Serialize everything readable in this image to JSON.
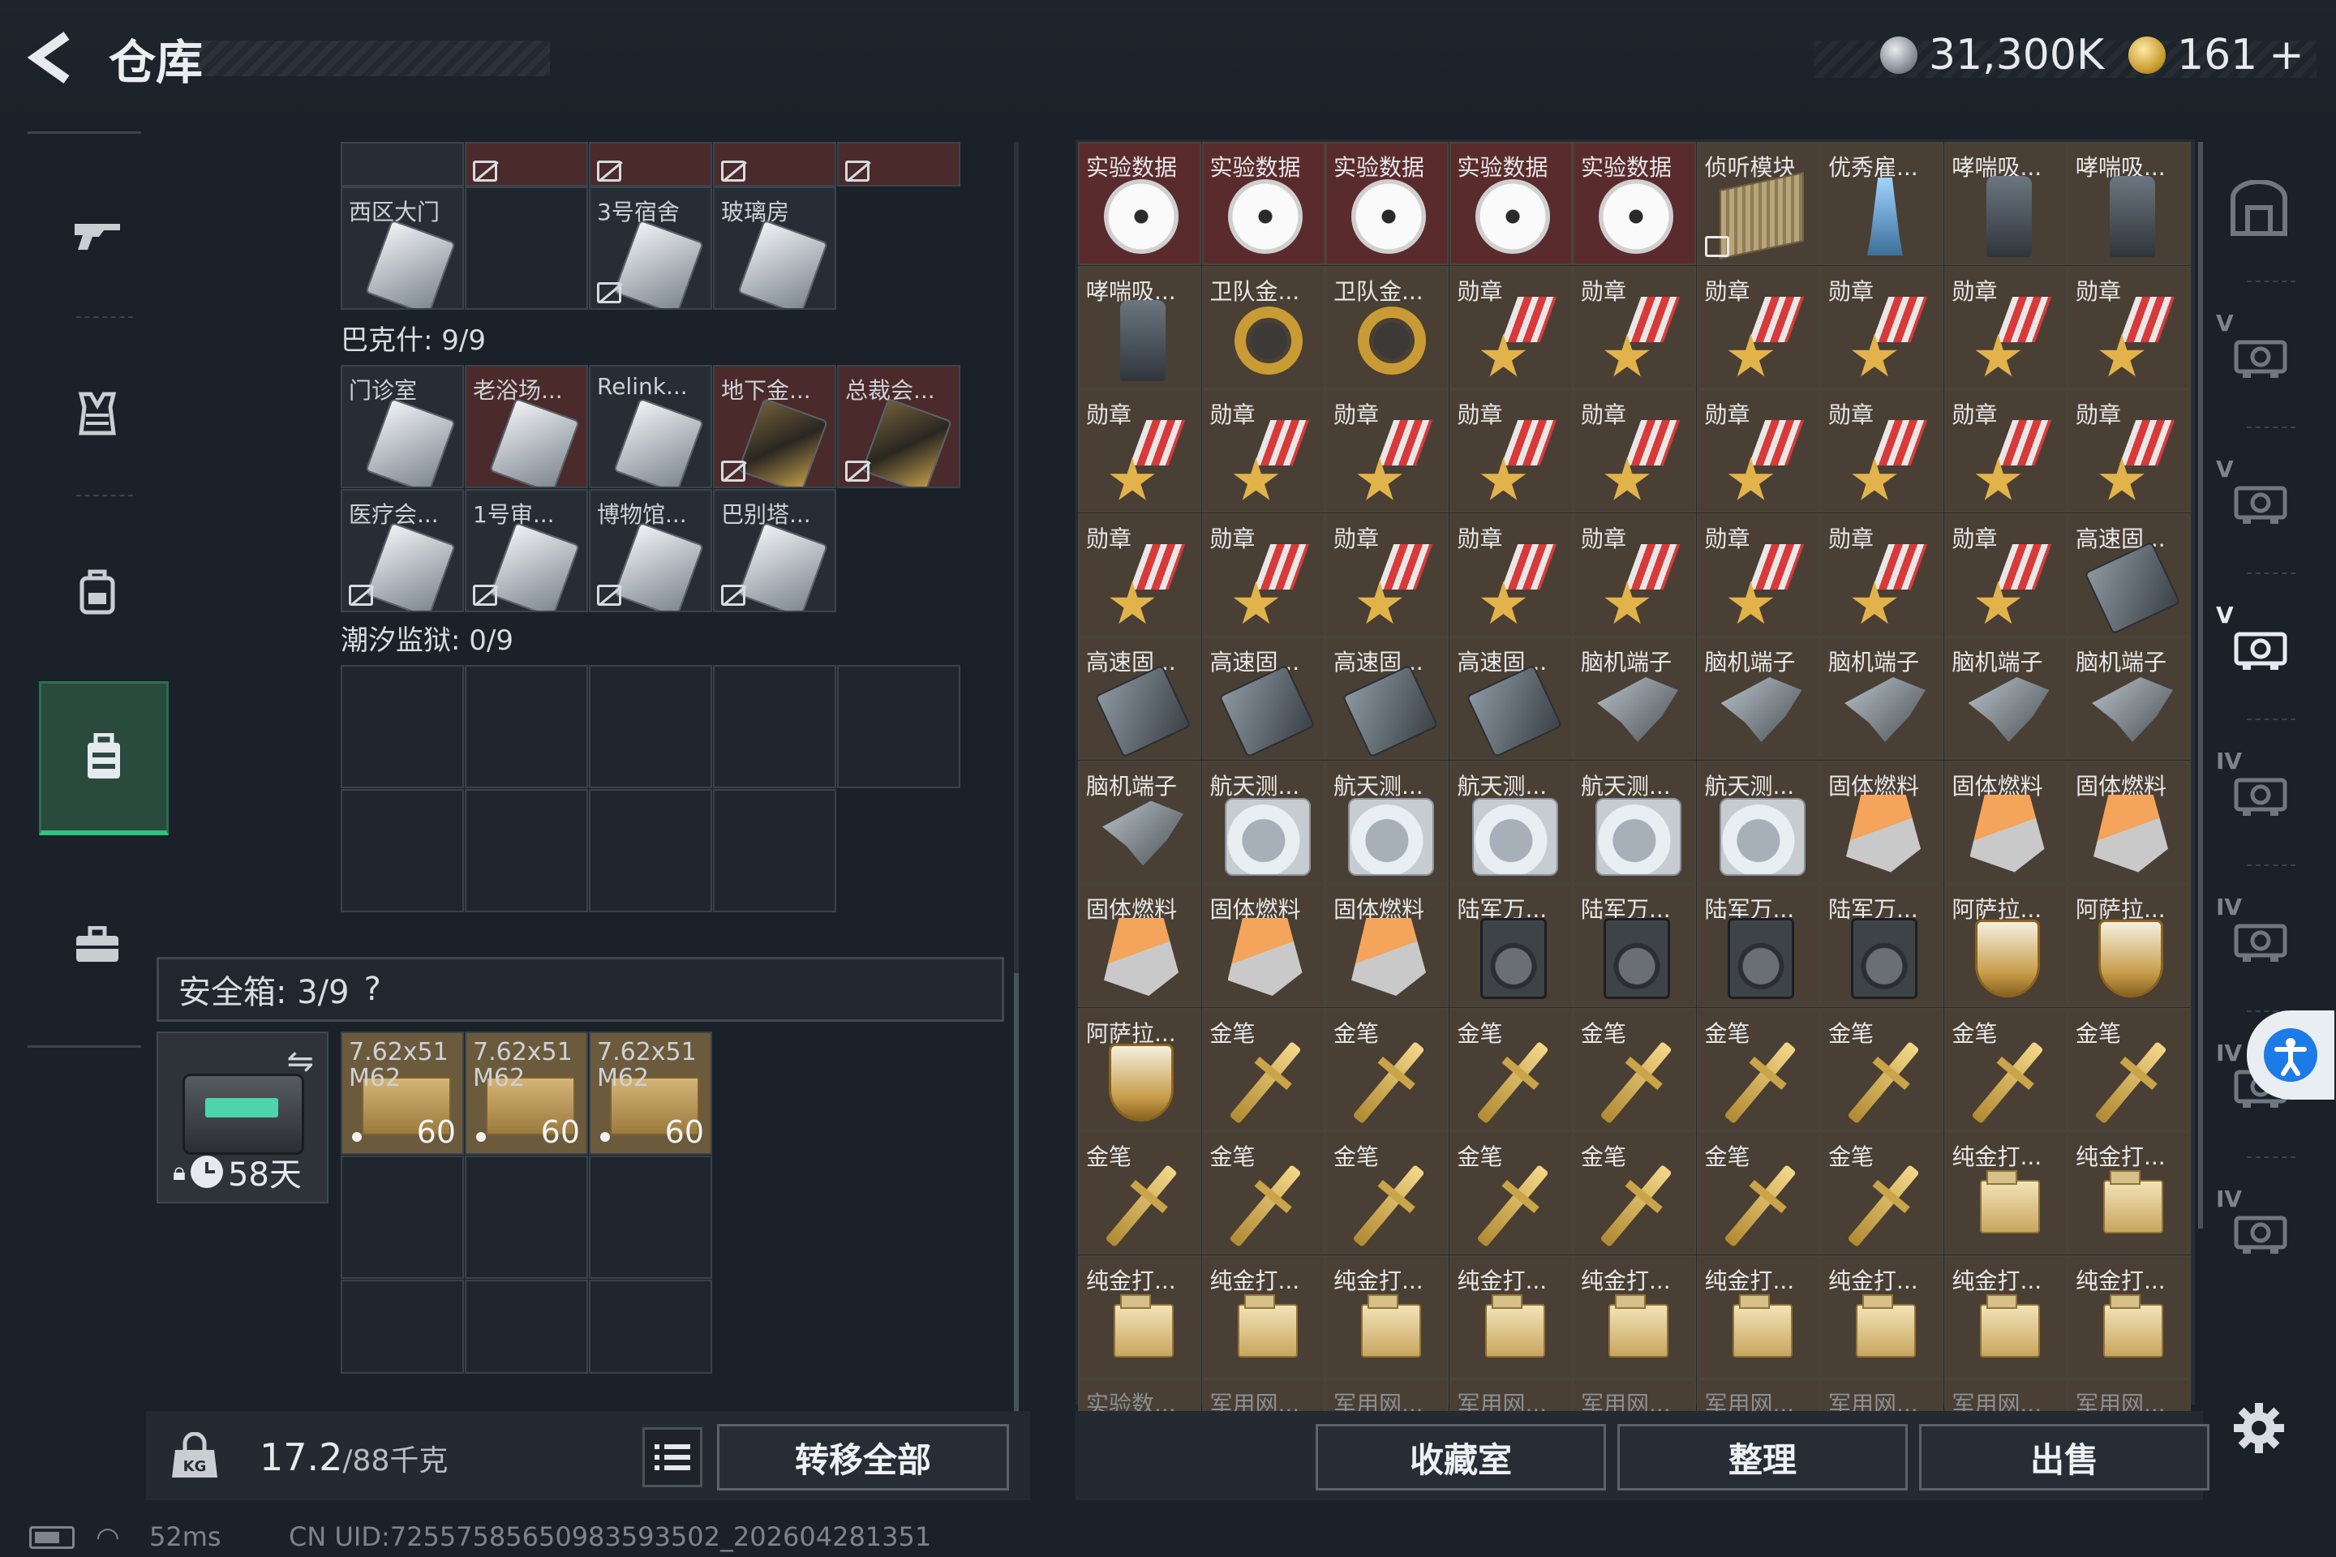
{
  "header": {
    "title": "仓库",
    "silver": "31,300K",
    "gold": "161",
    "gold_plus": "+"
  },
  "nav": {
    "items": [
      "weapon-icon",
      "armor-icon",
      "backpack-icon",
      "container-icon",
      "briefcase-icon"
    ],
    "active_index": 3
  },
  "keycards": {
    "top_row_labels": [
      "",
      "",
      "",
      "",
      ""
    ],
    "row1_labels": [
      "西区大门",
      "",
      "3号宿舍",
      "玻璃房"
    ],
    "section_bakshi": "巴克什: 9/9",
    "bakshi_row1": [
      "门诊室",
      "老浴场...",
      "Relink...",
      "地下金...",
      "总裁会..."
    ],
    "bakshi_row2": [
      "医疗会...",
      "1号审...",
      "博物馆...",
      "巴别塔..."
    ],
    "section_prison": "潮汐监狱: 0/9"
  },
  "safebox": {
    "label": "安全箱: 3/9",
    "help": "?",
    "days": "58天",
    "ammo": [
      {
        "name": "7.62x51 M62",
        "count": "60"
      },
      {
        "name": "7.62x51 M62",
        "count": "60"
      },
      {
        "name": "7.62x51 M62",
        "count": "60"
      }
    ]
  },
  "weight": {
    "current": "17.2",
    "max": "/88千克"
  },
  "buttons": {
    "transfer_all": "转移全部",
    "collection": "收藏室",
    "sort": "整理",
    "sell": "出售"
  },
  "stash": {
    "rows": [
      [
        [
          "实验数据",
          "disc"
        ],
        [
          "实验数据",
          "disc"
        ],
        [
          "实验数据",
          "disc"
        ],
        [
          "实验数据",
          "disc"
        ],
        [
          "实验数据",
          "disc"
        ],
        [
          "侦听模块",
          "module"
        ],
        [
          "优秀雇...",
          "trophy"
        ],
        [
          "哮喘吸...",
          "inhaler"
        ],
        [
          "哮喘吸...",
          "inhaler"
        ]
      ],
      [
        [
          "哮喘吸...",
          "inhaler"
        ],
        [
          "卫队金...",
          "ring"
        ],
        [
          "卫队金...",
          "ring"
        ],
        [
          "勋章",
          "medal"
        ],
        [
          "勋章",
          "medal"
        ],
        [
          "勋章",
          "medal"
        ],
        [
          "勋章",
          "medal"
        ],
        [
          "勋章",
          "medal"
        ],
        [
          "勋章",
          "medal"
        ]
      ],
      [
        [
          "勋章",
          "medal"
        ],
        [
          "勋章",
          "medal"
        ],
        [
          "勋章",
          "medal"
        ],
        [
          "勋章",
          "medal"
        ],
        [
          "勋章",
          "medal"
        ],
        [
          "勋章",
          "medal"
        ],
        [
          "勋章",
          "medal"
        ],
        [
          "勋章",
          "medal"
        ],
        [
          "勋章",
          "medal"
        ]
      ],
      [
        [
          "勋章",
          "medal"
        ],
        [
          "勋章",
          "medal"
        ],
        [
          "勋章",
          "medal"
        ],
        [
          "勋章",
          "medal"
        ],
        [
          "勋章",
          "medal"
        ],
        [
          "勋章",
          "medal"
        ],
        [
          "勋章",
          "medal"
        ],
        [
          "勋章",
          "medal"
        ],
        [
          "高速固...",
          "drive"
        ]
      ],
      [
        [
          "高速固...",
          "drive"
        ],
        [
          "高速固...",
          "drive"
        ],
        [
          "高速固...",
          "drive"
        ],
        [
          "高速固...",
          "drive"
        ],
        [
          "脑机端子",
          "brain"
        ],
        [
          "脑机端子",
          "brain"
        ],
        [
          "脑机端子",
          "brain"
        ],
        [
          "脑机端子",
          "brain"
        ],
        [
          "脑机端子",
          "brain"
        ]
      ],
      [
        [
          "脑机端子",
          "brain"
        ],
        [
          "航天测...",
          "hdd"
        ],
        [
          "航天测...",
          "hdd"
        ],
        [
          "航天测...",
          "hdd"
        ],
        [
          "航天测...",
          "hdd"
        ],
        [
          "航天测...",
          "hdd"
        ],
        [
          "固体燃料",
          "fuel"
        ],
        [
          "固体燃料",
          "fuel"
        ],
        [
          "固体燃料",
          "fuel"
        ]
      ],
      [
        [
          "固体燃料",
          "fuel"
        ],
        [
          "固体燃料",
          "fuel"
        ],
        [
          "固体燃料",
          "fuel"
        ],
        [
          "陆军万...",
          "radio"
        ],
        [
          "陆军万...",
          "radio"
        ],
        [
          "陆军万...",
          "radio"
        ],
        [
          "陆军万...",
          "radio"
        ],
        [
          "阿萨拉...",
          "cup"
        ],
        [
          "阿萨拉...",
          "cup"
        ]
      ],
      [
        [
          "阿萨拉...",
          "cup"
        ],
        [
          "金笔",
          "pen"
        ],
        [
          "金笔",
          "pen"
        ],
        [
          "金笔",
          "pen"
        ],
        [
          "金笔",
          "pen"
        ],
        [
          "金笔",
          "pen"
        ],
        [
          "金笔",
          "pen"
        ],
        [
          "金笔",
          "pen"
        ],
        [
          "金笔",
          "pen"
        ]
      ],
      [
        [
          "金笔",
          "pen"
        ],
        [
          "金笔",
          "pen"
        ],
        [
          "金笔",
          "pen"
        ],
        [
          "金笔",
          "pen"
        ],
        [
          "金笔",
          "pen"
        ],
        [
          "金笔",
          "pen"
        ],
        [
          "金笔",
          "pen"
        ],
        [
          "纯金打...",
          "lighter"
        ],
        [
          "纯金打...",
          "lighter"
        ]
      ],
      [
        [
          "纯金打...",
          "lighter"
        ],
        [
          "纯金打...",
          "lighter"
        ],
        [
          "纯金打...",
          "lighter"
        ],
        [
          "纯金打...",
          "lighter"
        ],
        [
          "纯金打...",
          "lighter"
        ],
        [
          "纯金打...",
          "lighter"
        ],
        [
          "纯金打...",
          "lighter"
        ],
        [
          "纯金打...",
          "lighter"
        ],
        [
          "纯金打...",
          "lighter"
        ]
      ],
      [
        [
          "实验数...",
          ""
        ],
        [
          "军用网...",
          ""
        ],
        [
          "军用网...",
          ""
        ],
        [
          "军用网...",
          ""
        ],
        [
          "军用网...",
          ""
        ],
        [
          "军用网...",
          ""
        ],
        [
          "军用网...",
          ""
        ],
        [
          "军用网...",
          ""
        ],
        [
          "军用网...",
          ""
        ]
      ]
    ]
  },
  "right_tabs": [
    "safe-icon",
    "V",
    "V",
    "V",
    "IV",
    "IV",
    "IV",
    "IV"
  ],
  "status": {
    "ping": "52ms",
    "uid": "CN UID:7255758565098359350​2_202604281351"
  }
}
